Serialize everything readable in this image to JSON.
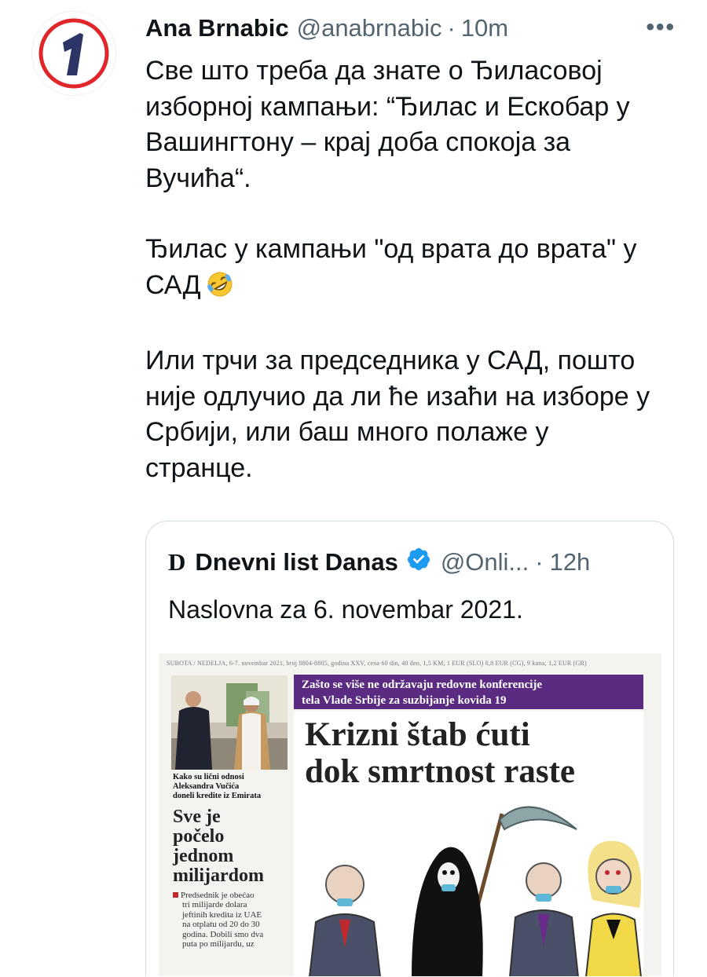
{
  "tweet": {
    "display_name": "Ana Brnabic",
    "handle": "@anabrnabic",
    "separator": "·",
    "time": "10m",
    "more_label": "•••",
    "avatar_text": "1",
    "text_lines": [
      "Све што треба да знате о Ђиласовој",
      "изборној кампањи: “Ђилас и Ескобар у",
      "Вашингтону – крај доба спокоја за",
      "Вучића“."
    ],
    "text_lines_2": [
      "Ђилас у кампањи \"од врата до врата\" у",
      "САД"
    ],
    "text_lines_3": [
      "Или трчи за председника у САД, пошто",
      "није одлучио да ли ће изаћи на изборе у",
      "Србији, или баш много полаже у",
      "странце."
    ],
    "emoji_name": "rolling-on-floor-laughing-emoji"
  },
  "quote": {
    "logo": "D",
    "name": "Dnevni list Danas",
    "handle": "@Onli...",
    "separator": "·",
    "time": "12h",
    "text": "Naslovna za 6. novembar 2021.",
    "verified_color": "#1d9bf0",
    "newspaper": {
      "date_strip": "SUBOTA / NEDELJA, 6-7. novembar 2021, broj 8804-8805, godina XXV, cena 60 din, 40 den, 1,5 KM, 1 EUR (SLO) 0,8 EUR (CG), 9 kuna, 1,2 EUR (GR)",
      "banner": [
        "Zašto se više ne održavaju redovne konferencije",
        "tela Vlade Srbije za suzbijanje kovida 19"
      ],
      "headline": [
        "Krizni štab ćuti",
        "dok smrtnost raste"
      ],
      "photo_caption": [
        "Kako su lični odnosi",
        "Aleksandra Vučića",
        "doneli kredite iz Emirata"
      ],
      "side_headline": [
        "Sve je",
        "počelo",
        "jednom",
        "milijardom"
      ],
      "side_body": [
        "Predsednik je obećao",
        "tri milijarde dolara",
        "jeftinih kredita iz UAE",
        "na otplatu od 20 do 30",
        "godina. Dobili smo dva",
        "puta po milijardu, uz"
      ],
      "banner_color": "#5a2b80"
    }
  }
}
